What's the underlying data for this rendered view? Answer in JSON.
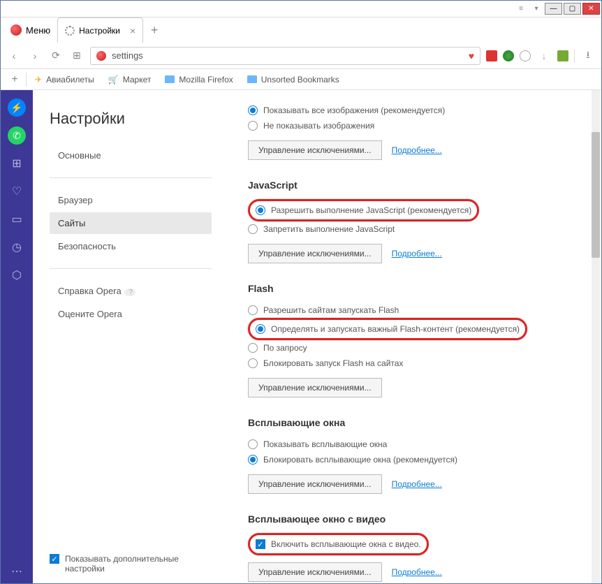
{
  "window": {
    "minimize": "—",
    "maximize": "▢",
    "close": "✕",
    "dropdown": "▾",
    "extra": "≡"
  },
  "menu": {
    "label": "Меню"
  },
  "tab": {
    "title": "Настройки"
  },
  "url": {
    "value": "settings"
  },
  "bookmarks": {
    "items": [
      {
        "label": "Авиабилеты"
      },
      {
        "label": "Маркет"
      },
      {
        "label": "Mozilla Firefox"
      },
      {
        "label": "Unsorted Bookmarks"
      }
    ]
  },
  "sidebar": {
    "title": "Настройки",
    "links": {
      "basic": "Основные",
      "browser": "Браузер",
      "sites": "Сайты",
      "security": "Безопасность",
      "help": "Справка Opera",
      "rate": "Оцените Opera"
    },
    "advanced": "Показывать дополнительные настройки"
  },
  "content": {
    "images": {
      "show_all": "Показывать все изображения (рекомендуется)",
      "hide": "Не показывать изображения"
    },
    "js": {
      "title": "JavaScript",
      "allow": "Разрешить выполнение JavaScript (рекомендуется)",
      "deny": "Запретить выполнение JavaScript"
    },
    "flash": {
      "title": "Flash",
      "allow": "Разрешить сайтам запускать Flash",
      "detect": "Определять и запускать важный Flash-контент (рекомендуется)",
      "ask": "По запросу",
      "block": "Блокировать запуск Flash на сайтах"
    },
    "popups": {
      "title": "Всплывающие окна",
      "show": "Показывать всплывающие окна",
      "block": "Блокировать всплывающие окна (рекомендуется)"
    },
    "video": {
      "title": "Всплывающее окно с видео",
      "enable": "Включить всплывающие окна с видео."
    },
    "manage": "Управление исключениями...",
    "more": "Подробнее..."
  }
}
